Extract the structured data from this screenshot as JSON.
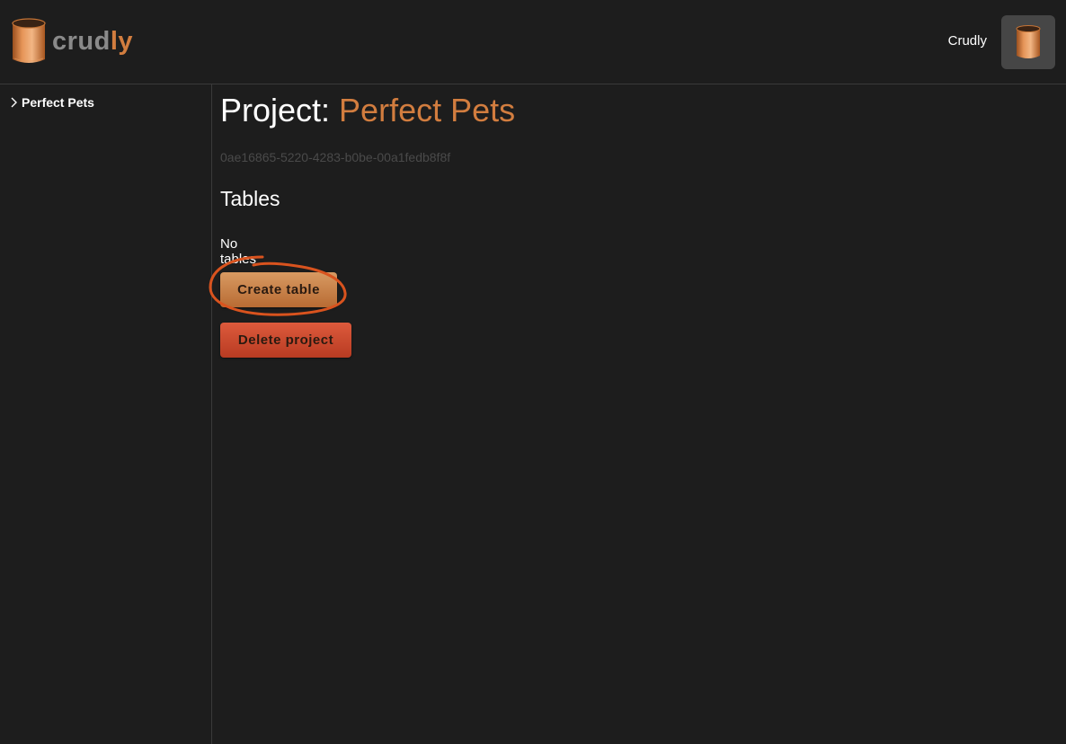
{
  "app": {
    "brand_crud": "crud",
    "brand_ly": "ly",
    "user_name": "Crudly"
  },
  "sidebar": {
    "items": [
      {
        "label": "Perfect Pets"
      }
    ]
  },
  "main": {
    "title_prefix": "Project: ",
    "project_name": "Perfect Pets",
    "project_id": "0ae16865-5220-4283-b0be-00a1fedb8f8f",
    "tables_heading": "Tables",
    "empty_text": "No tables",
    "create_label": "Create table",
    "delete_label": "Delete project"
  },
  "colors": {
    "background": "#1d1d1d",
    "accent": "#d27d3f",
    "danger": "#c9462b",
    "annotation": "#d9531e"
  },
  "icons": {
    "logo": "cylinder-logo-icon",
    "avatar": "cylinder-avatar-icon",
    "chevron": "chevron-right-icon"
  }
}
